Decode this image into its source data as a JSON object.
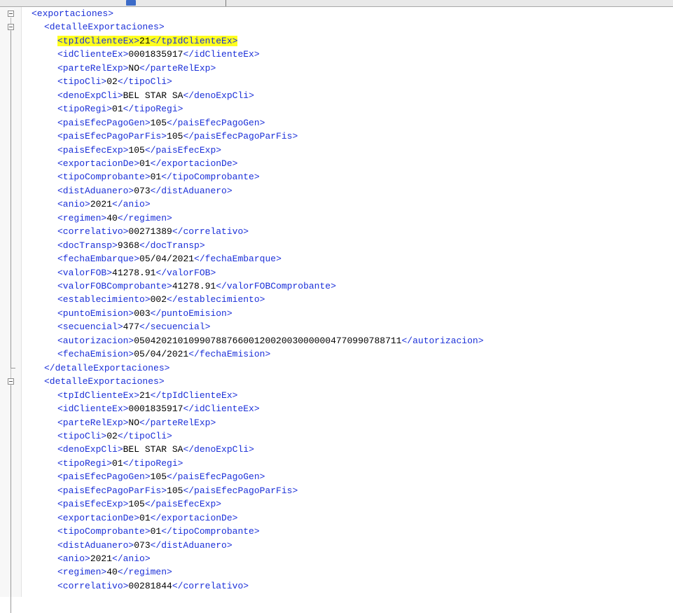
{
  "editor": {
    "root_open": "<exportaciones>",
    "blocks": [
      {
        "open": "<detalleExportaciones>",
        "close": "</detalleExportaciones>",
        "fields": [
          {
            "tag": "tpIdClienteEx",
            "value": "21",
            "highlight": true
          },
          {
            "tag": "idClienteEx",
            "value": "0001835917"
          },
          {
            "tag": "parteRelExp",
            "value": "NO"
          },
          {
            "tag": "tipoCli",
            "value": "02"
          },
          {
            "tag": "denoExpCli",
            "value": "BEL STAR SA"
          },
          {
            "tag": "tipoRegi",
            "value": "01"
          },
          {
            "tag": "paisEfecPagoGen",
            "value": "105"
          },
          {
            "tag": "paisEfecPagoParFis",
            "value": "105"
          },
          {
            "tag": "paisEfecExp",
            "value": "105"
          },
          {
            "tag": "exportacionDe",
            "value": "01"
          },
          {
            "tag": "tipoComprobante",
            "value": "01"
          },
          {
            "tag": "distAduanero",
            "value": "073"
          },
          {
            "tag": "anio",
            "value": "2021"
          },
          {
            "tag": "regimen",
            "value": "40"
          },
          {
            "tag": "correlativo",
            "value": "00271389"
          },
          {
            "tag": "docTransp",
            "value": "9368"
          },
          {
            "tag": "fechaEmbarque",
            "value": "05/04/2021"
          },
          {
            "tag": "valorFOB",
            "value": "41278.91"
          },
          {
            "tag": "valorFOBComprobante",
            "value": "41278.91"
          },
          {
            "tag": "establecimiento",
            "value": "002"
          },
          {
            "tag": "puntoEmision",
            "value": "003"
          },
          {
            "tag": "secuencial",
            "value": "477"
          },
          {
            "tag": "autorizacion",
            "value": "0504202101099078876600120020030000004770990788711"
          },
          {
            "tag": "fechaEmision",
            "value": "05/04/2021"
          }
        ]
      },
      {
        "open": "<detalleExportaciones>",
        "close": null,
        "fields": [
          {
            "tag": "tpIdClienteEx",
            "value": "21"
          },
          {
            "tag": "idClienteEx",
            "value": "0001835917"
          },
          {
            "tag": "parteRelExp",
            "value": "NO"
          },
          {
            "tag": "tipoCli",
            "value": "02"
          },
          {
            "tag": "denoExpCli",
            "value": "BEL STAR SA"
          },
          {
            "tag": "tipoRegi",
            "value": "01"
          },
          {
            "tag": "paisEfecPagoGen",
            "value": "105"
          },
          {
            "tag": "paisEfecPagoParFis",
            "value": "105"
          },
          {
            "tag": "paisEfecExp",
            "value": "105"
          },
          {
            "tag": "exportacionDe",
            "value": "01"
          },
          {
            "tag": "tipoComprobante",
            "value": "01"
          },
          {
            "tag": "distAduanero",
            "value": "073"
          },
          {
            "tag": "anio",
            "value": "2021"
          },
          {
            "tag": "regimen",
            "value": "40"
          },
          {
            "tag": "correlativo",
            "value": "00281844"
          }
        ]
      }
    ]
  },
  "colors": {
    "tag": "#1a2fd8",
    "text": "#000000",
    "highlight": "#ffff1f"
  }
}
